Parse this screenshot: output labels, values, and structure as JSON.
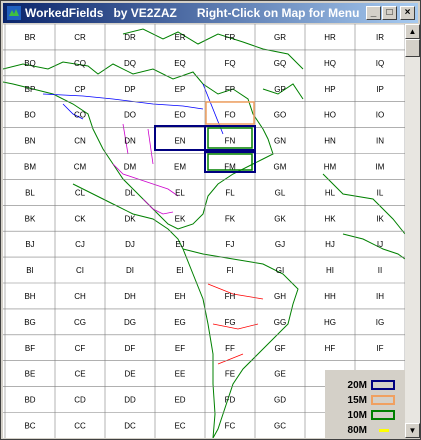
{
  "window": {
    "title": "WorkedFields   by VE2ZAZ      Right-Click on Map for Menu",
    "minimize_icon": "minimize-icon",
    "maximize_icon": "maximize-icon",
    "close_icon": "close-icon"
  },
  "grid": {
    "columns": [
      "B",
      "C",
      "D",
      "E",
      "F",
      "G",
      "H",
      "I"
    ],
    "rows": [
      "R",
      "Q",
      "P",
      "O",
      "N",
      "M",
      "L",
      "K",
      "J",
      "I",
      "H",
      "G",
      "F",
      "E",
      "D",
      "C"
    ],
    "visible_last_row_cols": [
      "B",
      "C",
      "D",
      "E",
      "F",
      "G"
    ]
  },
  "worked_squares": [
    {
      "label": "FN",
      "band": "20M"
    },
    {
      "label": "FM",
      "band": "10M"
    },
    {
      "label": "FO",
      "band": "15M"
    },
    {
      "label": "EN",
      "band": "20M"
    }
  ],
  "legend": {
    "items": [
      {
        "label": "20M",
        "color": "#000080",
        "style": "outline"
      },
      {
        "label": "15M",
        "color": "#f0a060",
        "style": "outline"
      },
      {
        "label": "10M",
        "color": "#008000",
        "style": "outline"
      },
      {
        "label": "80M",
        "color": "#ffff00",
        "style": "line"
      }
    ]
  },
  "colors": {
    "land": "#008000",
    "borders": "#0000ff",
    "states": "#cc00cc",
    "countries": "#ff0000"
  }
}
